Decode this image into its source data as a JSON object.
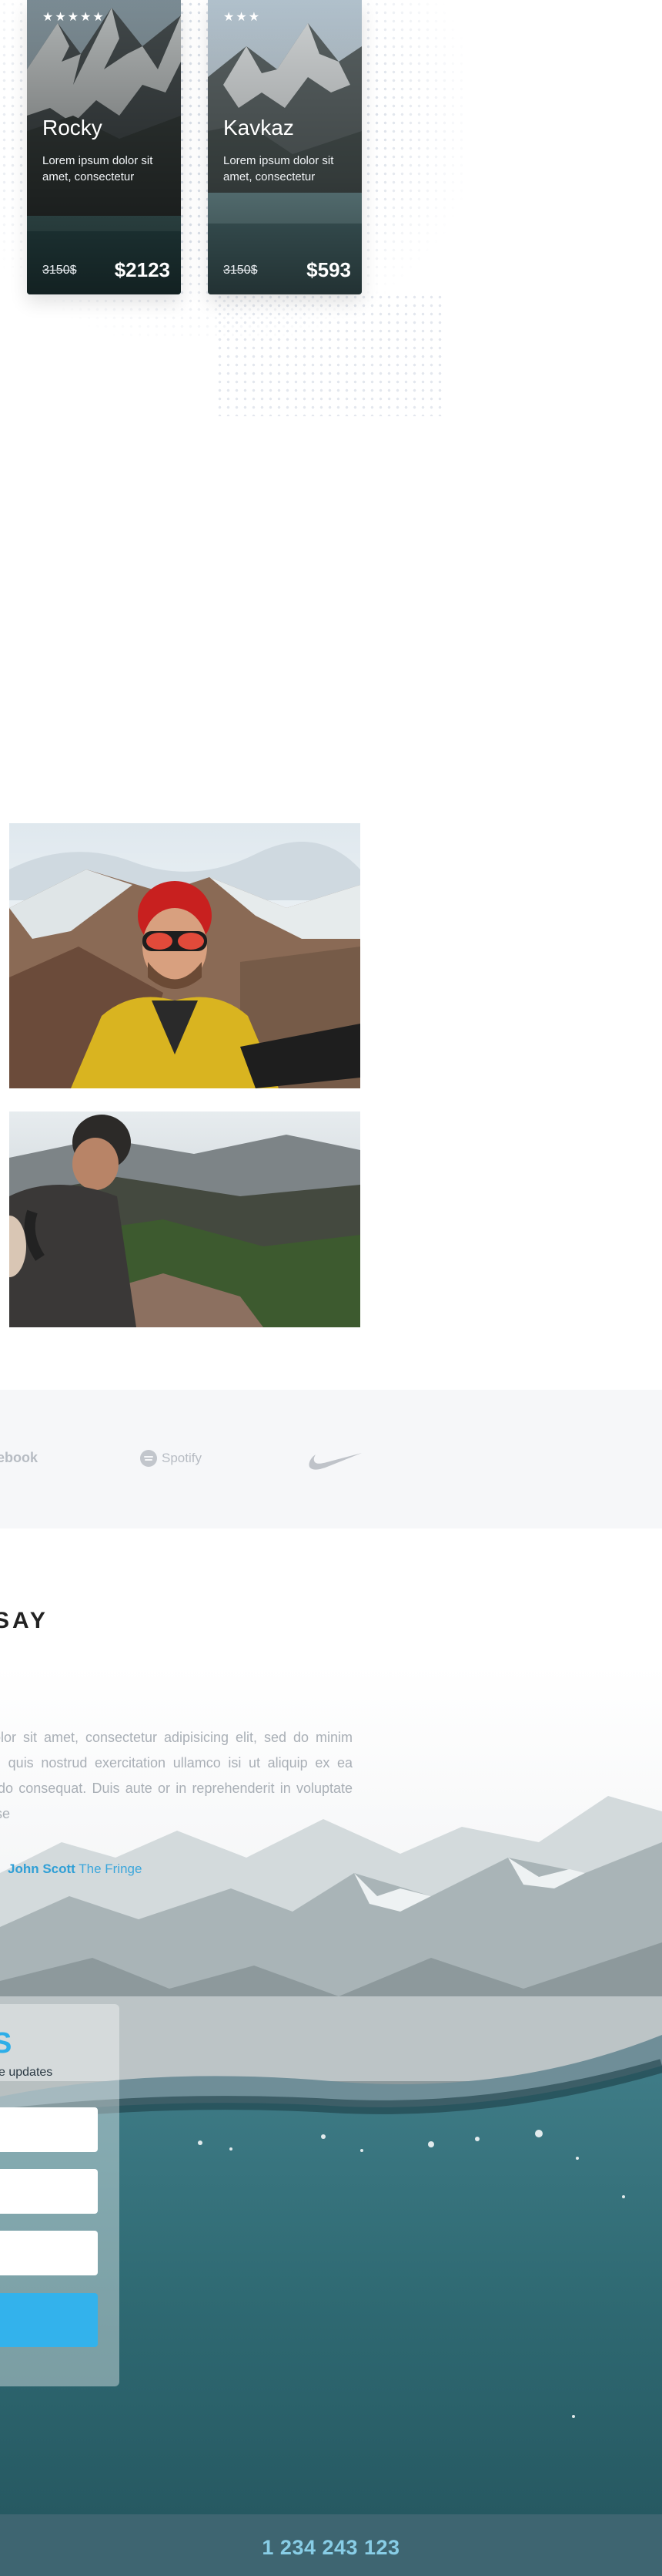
{
  "tours": [
    {
      "stars": "★★★★★",
      "name": "Rocky",
      "description": "Lorem ipsum dolor sit amet, consectetur",
      "old_price": "3150$",
      "price": "$2123"
    },
    {
      "stars": "★★★",
      "name": "Kavkaz",
      "description": "Lorem ipsum dolor sit amet, consectetur",
      "old_price": "3150$",
      "price": "$593"
    }
  ],
  "partners": {
    "facebook": "ebook",
    "spotify": "Spotify"
  },
  "testimonials": {
    "title": "SAY",
    "text": "sum dolor sit amet, consectetur adipisicing elit, sed do minim veniam, quis nostrud exercitation ullamco isi ut aliquip ex ea commodo consequat. Duis aute or in reprehenderit in voluptate velit esse",
    "author_name": "John Scott",
    "author_company": "The Fringe"
  },
  "subscribe": {
    "title": "S",
    "subtitle": "e updates"
  },
  "footer": {
    "phone": "1 234 243 123"
  }
}
